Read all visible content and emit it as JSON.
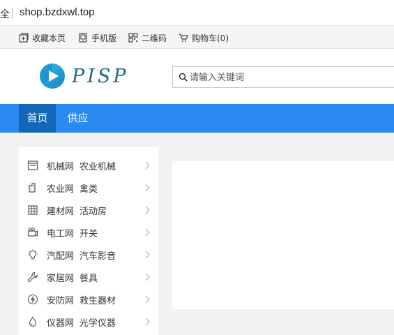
{
  "browser": {
    "secure_label": "全",
    "url": "shop.bzdxwl.top"
  },
  "topbar": {
    "links": [
      {
        "label": "收藏本页",
        "icon": "bookmark-icon"
      },
      {
        "label": "手机版",
        "icon": "mobile-icon"
      },
      {
        "label": "二维码",
        "icon": "qrcode-icon"
      },
      {
        "label": "购物车(0)",
        "icon": "cart-icon"
      }
    ]
  },
  "header": {
    "logo_text": "PISP",
    "search_placeholder": "请输入关键词"
  },
  "nav": {
    "items": [
      "首页",
      "供应"
    ]
  },
  "categories": [
    {
      "main": "机械网",
      "sub": "农业机械",
      "icon": "machine-icon"
    },
    {
      "main": "农业网",
      "sub": "禽类",
      "icon": "farm-icon"
    },
    {
      "main": "建材网",
      "sub": "活动房",
      "icon": "building-icon"
    },
    {
      "main": "电工网",
      "sub": "开关",
      "icon": "camera-icon"
    },
    {
      "main": "汽配网",
      "sub": "汽车影音",
      "icon": "bulb-icon"
    },
    {
      "main": "家居网",
      "sub": "餐具",
      "icon": "wrench-icon"
    },
    {
      "main": "安防网",
      "sub": "救生器材",
      "icon": "lightning-icon"
    },
    {
      "main": "仪器网",
      "sub": "光学仪器",
      "icon": "drop-icon"
    }
  ],
  "colors": {
    "nav_bg": "#2b8af2",
    "nav_active": "#1366b8",
    "logo": "#1c6a86"
  }
}
